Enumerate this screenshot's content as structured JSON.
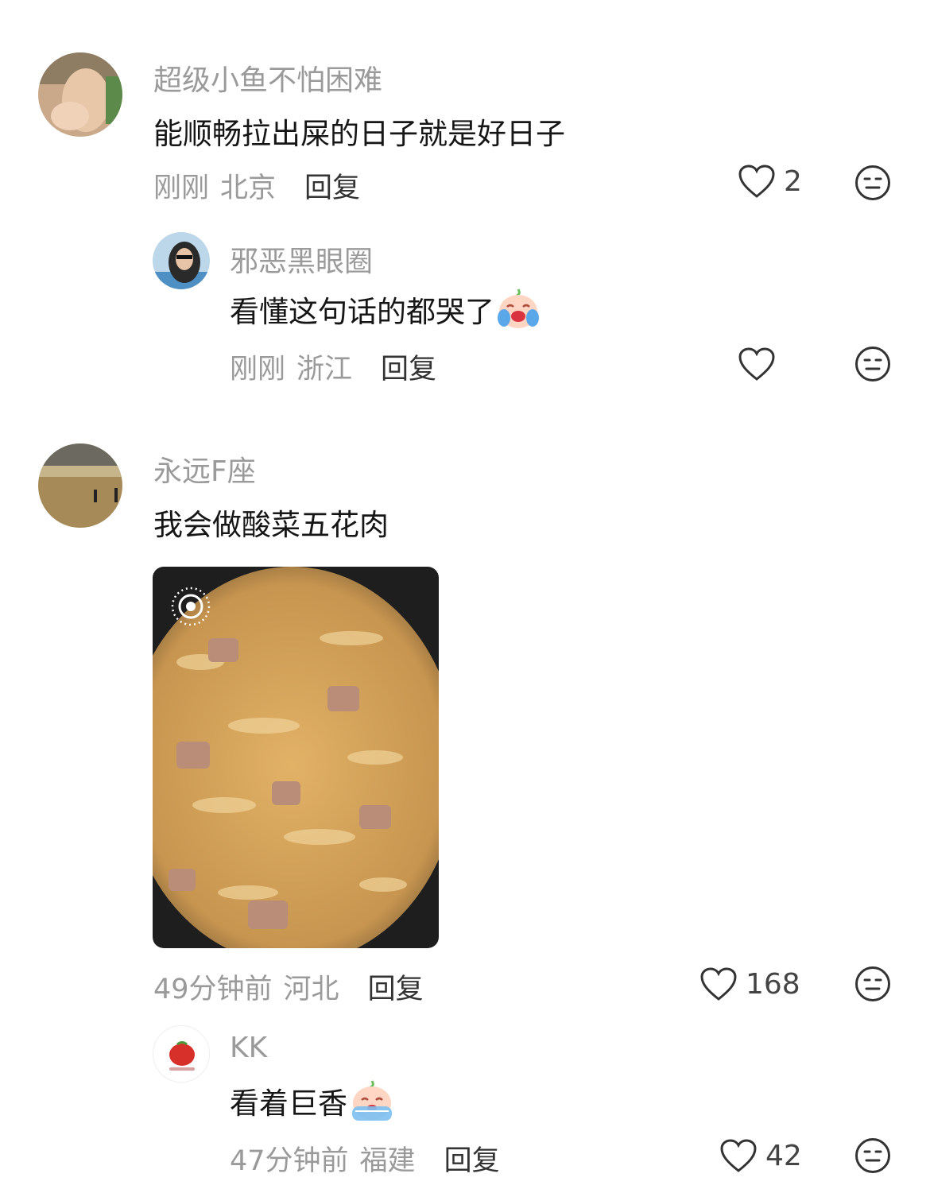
{
  "comments": [
    {
      "user": "超级小鱼不怕困难",
      "text": "能顺畅拉出屎的日子就是好日子",
      "time": "刚刚",
      "location": "北京",
      "reply": "回复",
      "likes": "2",
      "replies": [
        {
          "user": "邪恶黑眼圈",
          "text": "看懂这句话的都哭了",
          "emoji": "crying-face-emoji",
          "time": "刚刚",
          "location": "浙江",
          "reply": "回复",
          "likes": ""
        }
      ]
    },
    {
      "user": "永远F座",
      "text": "我会做酸菜五花肉",
      "image": "sauerkraut-pork-photo",
      "time": "49分钟前",
      "location": "河北",
      "reply": "回复",
      "likes": "168",
      "replies": [
        {
          "user": "KK",
          "text": "看着巨香",
          "emoji": "drooling-face-emoji",
          "time": "47分钟前",
          "location": "福建",
          "reply": "回复",
          "likes": "42"
        }
      ]
    }
  ],
  "icons": {
    "like": "heart-outline-icon",
    "dislike": "neutral-face-icon",
    "live_photo": "live-photo-icon"
  }
}
